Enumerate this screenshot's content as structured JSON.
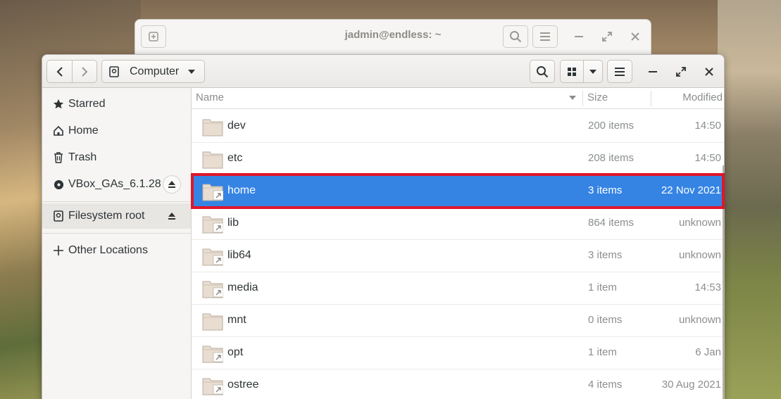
{
  "terminal": {
    "title": "jadmin@endless: ~"
  },
  "files": {
    "location": "Computer",
    "sidebar": [
      {
        "label": "Starred",
        "icon": "star-icon"
      },
      {
        "label": "Home",
        "icon": "home-icon"
      },
      {
        "label": "Trash",
        "icon": "trash-icon"
      },
      {
        "label": "VBox_GAs_6.1.28",
        "icon": "disc-icon"
      },
      {
        "label": "Filesystem root",
        "icon": "drive-icon"
      },
      {
        "label": "Other Locations",
        "icon": "plus-icon"
      }
    ],
    "columns": {
      "name": "Name",
      "size": "Size",
      "modified": "Modified"
    },
    "rows": [
      {
        "name": "dev",
        "size": "200 items",
        "modified": "14:50",
        "link": false
      },
      {
        "name": "etc",
        "size": "208 items",
        "modified": "14:50",
        "link": false
      },
      {
        "name": "home",
        "size": "3 items",
        "modified": "22 Nov 2021",
        "link": true,
        "selected": true
      },
      {
        "name": "lib",
        "size": "864 items",
        "modified": "unknown",
        "link": true
      },
      {
        "name": "lib64",
        "size": "3 items",
        "modified": "unknown",
        "link": true
      },
      {
        "name": "media",
        "size": "1 item",
        "modified": "14:53",
        "link": true
      },
      {
        "name": "mnt",
        "size": "0 items",
        "modified": "unknown",
        "link": false
      },
      {
        "name": "opt",
        "size": "1 item",
        "modified": "6 Jan",
        "link": true
      },
      {
        "name": "ostree",
        "size": "4 items",
        "modified": "30 Aug 2021",
        "link": true
      }
    ]
  },
  "colors": {
    "selection": "#3584e4",
    "highlight_box": "#e0162b"
  }
}
